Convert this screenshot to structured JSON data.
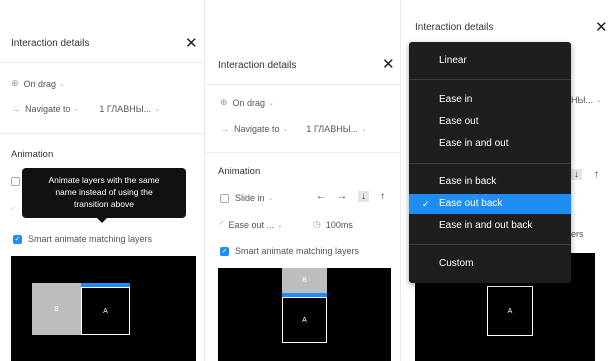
{
  "panel1": {
    "title": "Interaction details",
    "trigger": "On drag",
    "action": "Navigate to",
    "destination": "1 ГЛАВНЫ...",
    "section": "Animation",
    "smart_animate": "Smart animate matching layers",
    "tooltip_lines": [
      "Animate layers with the same",
      "name instead of using the",
      "transition above"
    ],
    "frame_b": "B",
    "frame_a": "A"
  },
  "panel2": {
    "title": "Interaction details",
    "trigger": "On drag",
    "action": "Navigate to",
    "destination": "1 ГЛАВНЫ...",
    "section": "Animation",
    "transition": "Slide in",
    "easing": "Ease out ...",
    "duration": "100ms",
    "smart_animate": "Smart animate matching layers",
    "frame_b": "B",
    "frame_a": "A"
  },
  "panel3": {
    "title": "Interaction details",
    "destination_partial": "НЫ...",
    "smart_partial": "ers",
    "frame_a": "A"
  },
  "dropdown": {
    "items": [
      "Linear",
      "Ease in",
      "Ease out",
      "Ease in and out",
      "Ease in back",
      "Ease out back",
      "Ease in and out back",
      "Custom"
    ],
    "selected": "Ease out back"
  },
  "icons": {
    "close": "close-icon",
    "trigger": "drag-icon",
    "action": "arrow-right-icon",
    "check": "check-icon"
  },
  "colors": {
    "accent": "#1e8ef5",
    "tooltip": "#111111",
    "dropdown_bg": "#1e1e1e"
  }
}
